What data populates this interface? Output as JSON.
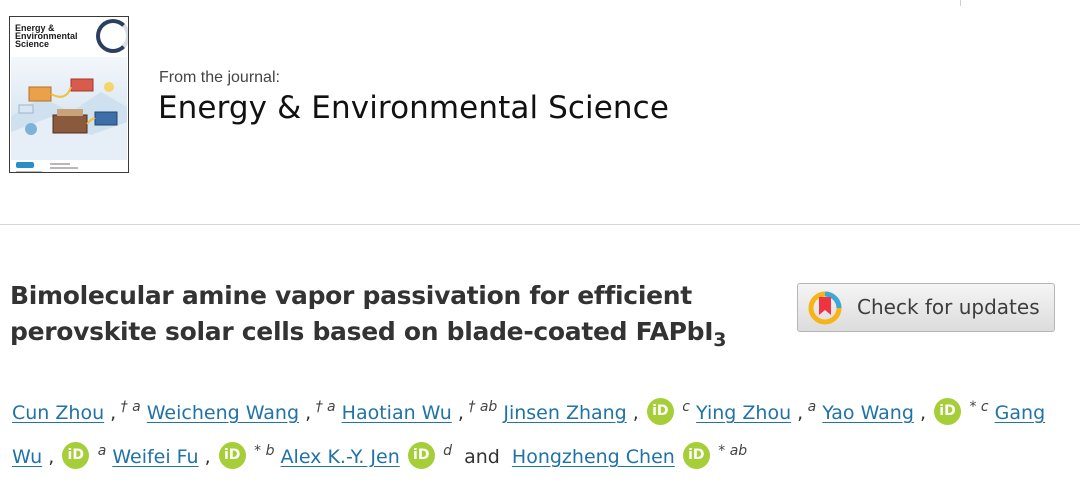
{
  "journal": {
    "cover_title": "Energy &\nEnvironmental\nScience",
    "from_label": "From the journal:",
    "name": "Energy & Environmental Science"
  },
  "article": {
    "title_main": "Bimolecular amine vapor passivation for efficient perovskite solar cells based on blade-coated FAPbI",
    "title_subscript": "3"
  },
  "check_updates": {
    "label": "Check for updates"
  },
  "authors": {
    "orcid_icon_text": "iD",
    "conjunction": "and",
    "list": [
      {
        "name": "Cun Zhou",
        "sep": ",",
        "marks": "†",
        "aff": "a"
      },
      {
        "name": "Weicheng Wang",
        "sep": ",",
        "marks": "†",
        "aff": "a"
      },
      {
        "name": "Haotian Wu",
        "sep": ",",
        "marks": "†",
        "aff": "ab"
      },
      {
        "name": "Jinsen Zhang",
        "sep": ",",
        "marks": "",
        "aff": "c"
      },
      {
        "name": "Ying Zhou",
        "sep": ",",
        "marks": "",
        "aff": "a"
      },
      {
        "name": "Yao Wang",
        "sep": ",",
        "marks": "*",
        "aff": "c"
      },
      {
        "name": "Gang Wu",
        "sep": ",",
        "marks": "",
        "aff": "a"
      },
      {
        "name": "Weifei Fu",
        "sep": ",",
        "marks": "*",
        "aff": "b"
      },
      {
        "name": "Alex K.-Y. Jen",
        "sep": "",
        "marks": "",
        "aff": "d"
      },
      {
        "name": "Hongzheng Chen",
        "sep": "",
        "marks": "*",
        "aff": "ab"
      }
    ]
  },
  "colors": {
    "link": "#2172a8",
    "orcid": "#a6ce39",
    "title": "#333333",
    "crossmark_red": "#ef3340",
    "crossmark_yellow": "#f7b416"
  }
}
